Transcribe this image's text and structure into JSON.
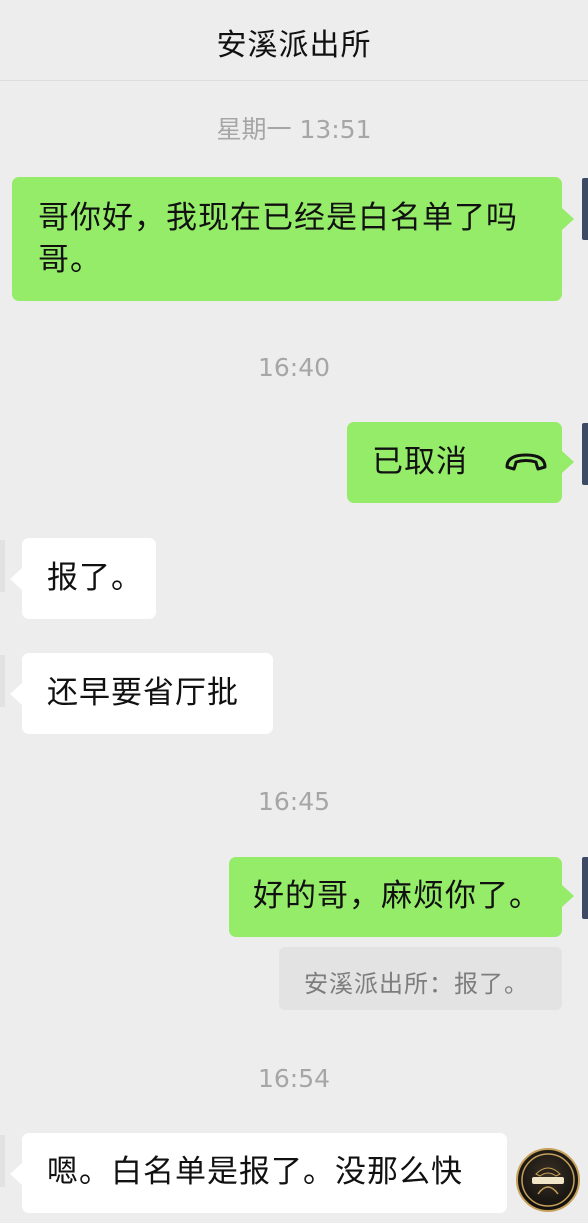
{
  "header": {
    "title": "安溪派出所"
  },
  "messages": {
    "ts1": "星期一 13:51",
    "m1_line1": "哥你好，我现在已经是白名单了吗",
    "m1_line2": "哥。",
    "ts2": "16:40",
    "m2": "已取消",
    "m3": "报了。",
    "m4": "还早要省厅批",
    "ts3": "16:45",
    "m5": "好的哥，麻烦你了。",
    "m5_quote": "安溪派出所：报了。",
    "ts4": "16:54",
    "m6": "嗯。白名单是报了。没那么快"
  },
  "icons": {
    "call": "phone-hangup-icon",
    "watermark": "watermark-logo"
  },
  "colors": {
    "background": "#ededed",
    "my_bubble": "#95ec69",
    "other_bubble": "#ffffff",
    "timestamp": "#a6a6a6",
    "quote_bg": "#e3e3e3"
  }
}
